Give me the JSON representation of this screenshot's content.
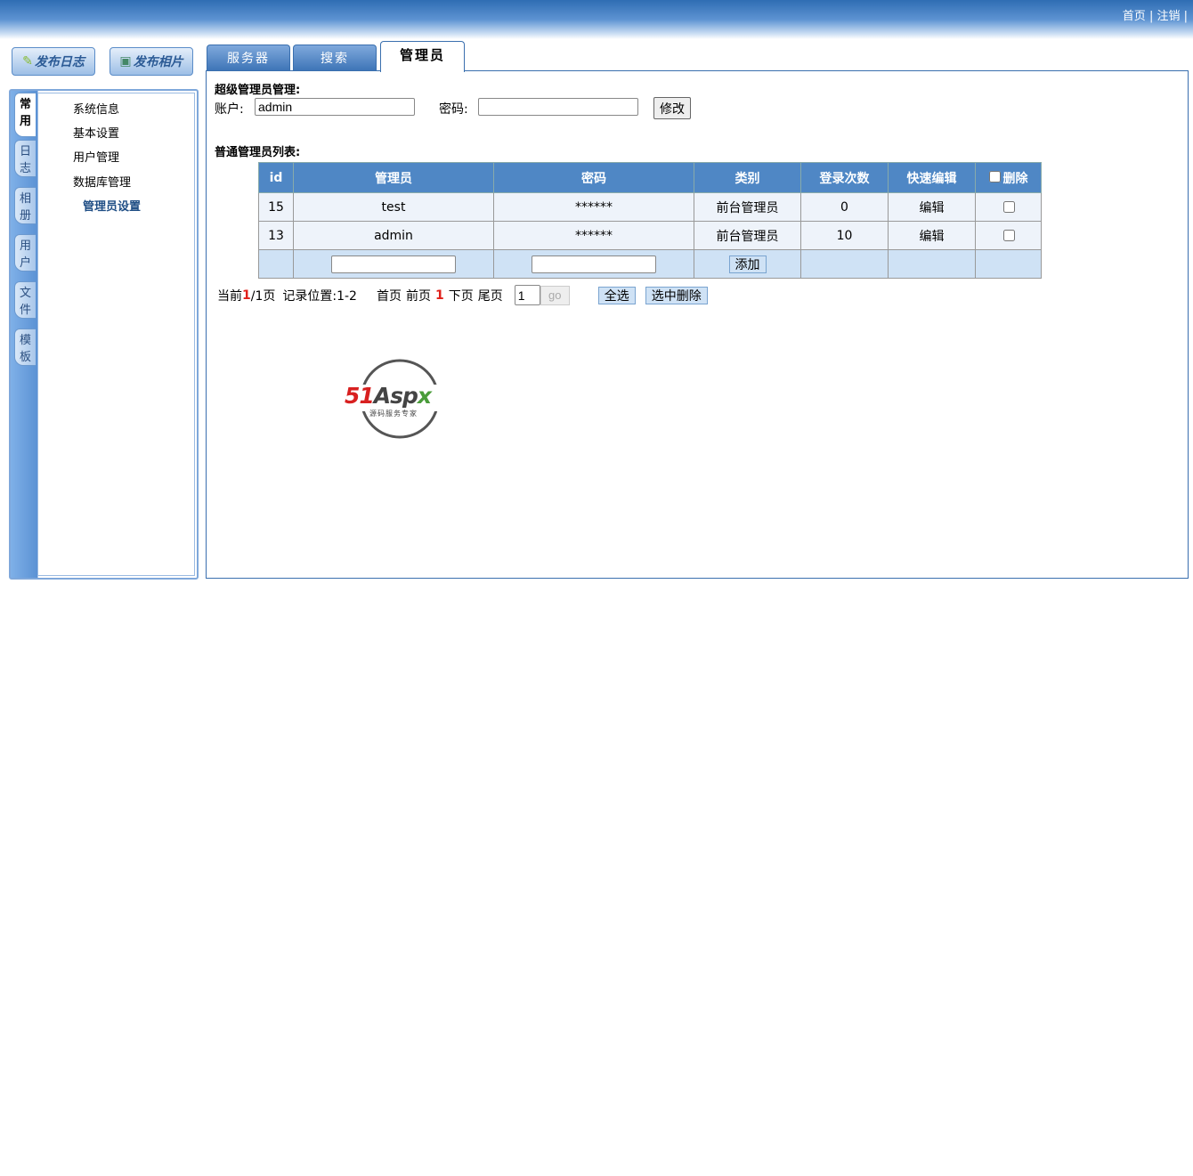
{
  "top": {
    "home": "首页",
    "logout": "注销"
  },
  "buttons": {
    "publish_log": "发布日志",
    "publish_photo": "发布相片"
  },
  "vtabs": [
    "常用",
    "日志",
    "相册",
    "用户",
    "文件",
    "模板"
  ],
  "menu": [
    "系统信息",
    "基本设置",
    "用户管理",
    "数据库管理",
    "管理员设置"
  ],
  "tabs": [
    "服务器",
    "搜索",
    "管理员"
  ],
  "super": {
    "title": "超级管理员管理:",
    "account_label": "账户:",
    "account_value": "admin",
    "password_label": "密码:",
    "password_value": "",
    "modify": "修改"
  },
  "list": {
    "title": "普通管理员列表:",
    "headers": [
      "id",
      "管理员",
      "密码",
      "类别",
      "登录次数",
      "快速编辑",
      "删除"
    ],
    "rows": [
      [
        "15",
        "test",
        "******",
        "前台管理员",
        "0",
        "编辑"
      ],
      [
        "13",
        "admin",
        "******",
        "前台管理员",
        "10",
        "编辑"
      ]
    ],
    "add": "添加"
  },
  "pager": {
    "current_prefix": "当前",
    "current": "1",
    "total": "/1页",
    "records": "记录位置:1-2",
    "first": "首页",
    "prev": "前页",
    "page": "1",
    "next": "下页",
    "last": "尾页",
    "goto_value": "1",
    "go": "go",
    "select_all": "全选",
    "delete_selected": "选中删除"
  },
  "logo": {
    "text": "51Aspx",
    "sub": "源码服务专家"
  }
}
